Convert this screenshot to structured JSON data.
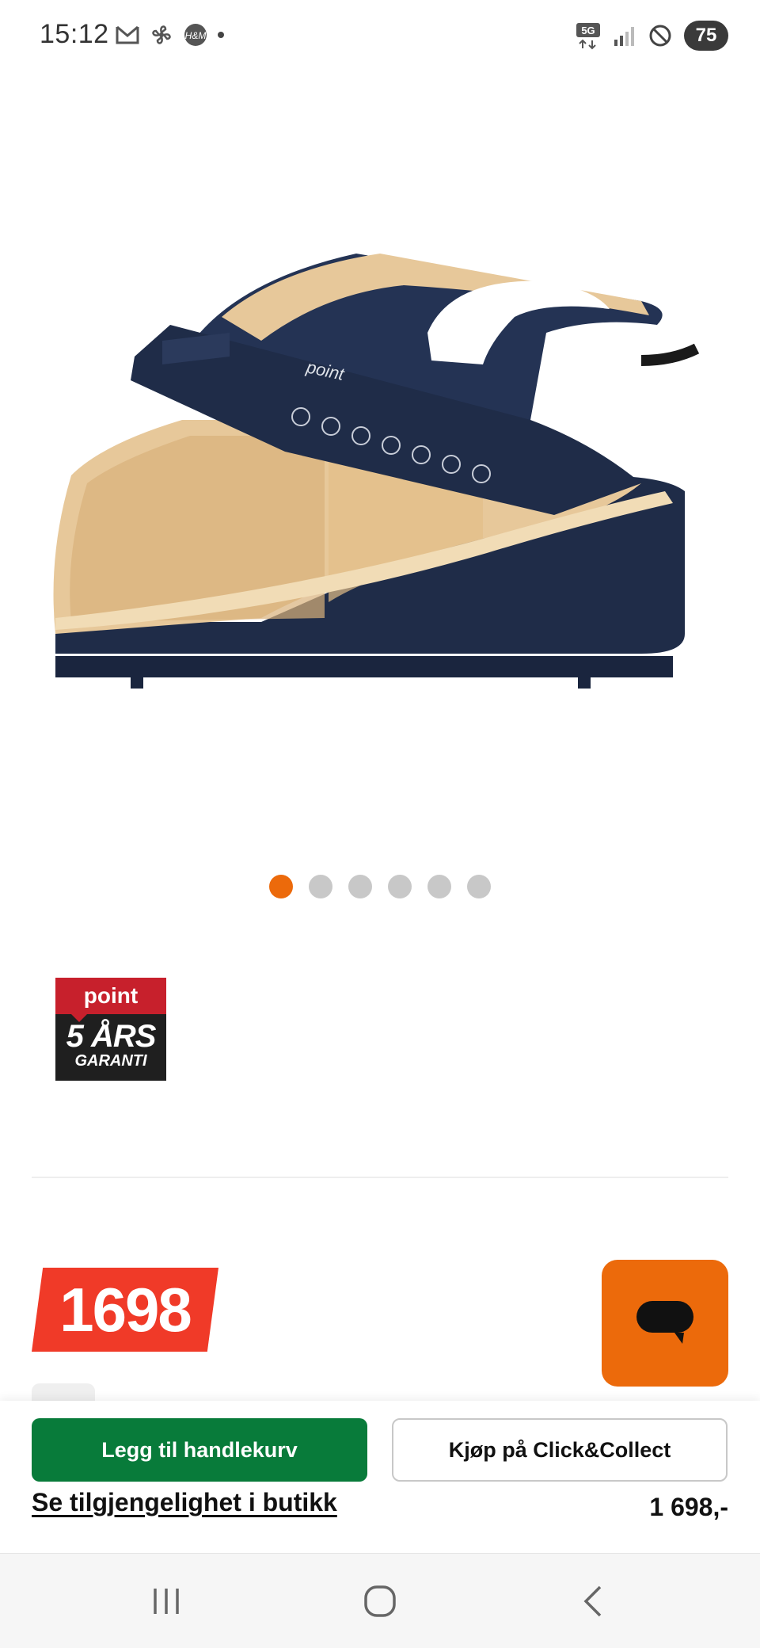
{
  "status_bar": {
    "time": "15:12",
    "network": "5G",
    "battery": "75"
  },
  "product": {
    "brand_logo": "point",
    "carousel": {
      "total": 6,
      "active_index": 0
    }
  },
  "warranty_badge": {
    "brand": "point",
    "years": "5 ÅRS",
    "label": "GARANTI"
  },
  "price": {
    "tag": "1698",
    "display": "1 698,-"
  },
  "actions": {
    "add_to_cart": "Legg til handlekurv",
    "click_collect": "Kjøp på Click&Collect",
    "availability_link": "Se tilgjengelighet i butikk"
  },
  "colors": {
    "accent_orange": "#ec6a0b",
    "price_red": "#f03a28",
    "cart_green": "#087b3a"
  },
  "icons": {
    "chat": "chat-bubble-icon",
    "nav_recents": "recents-icon",
    "nav_home": "home-icon",
    "nav_back": "back-icon"
  }
}
